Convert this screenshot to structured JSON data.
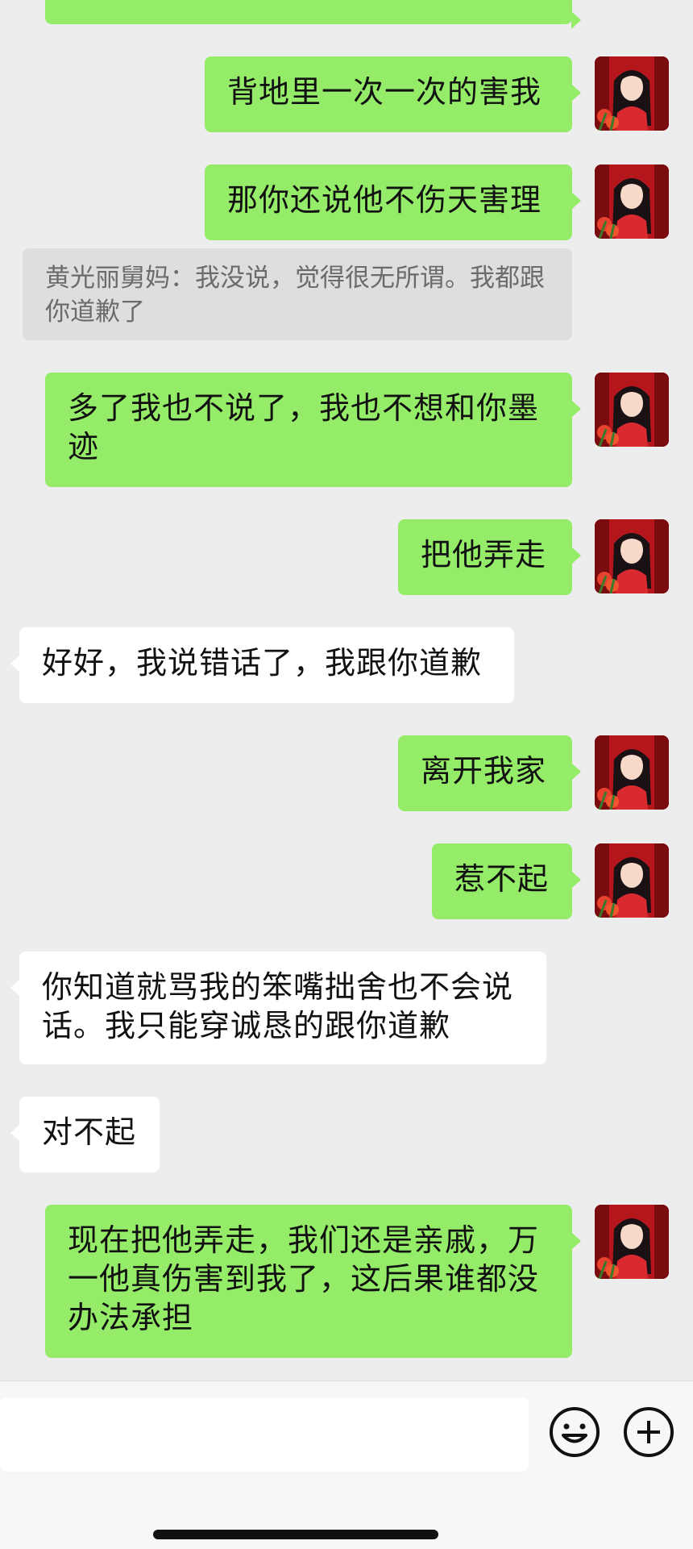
{
  "messages": [
    {
      "side": "me",
      "text": "背地里一次一次的害我"
    },
    {
      "side": "me",
      "text": "那你还说他不伤天害理"
    },
    {
      "side": "quote",
      "text": "黄光丽舅妈：我没说，觉得很无所谓。我都跟你道歉了"
    },
    {
      "side": "me",
      "text": "多了我也不说了，我也不想和你墨迹"
    },
    {
      "side": "me",
      "text": "把他弄走"
    },
    {
      "side": "other",
      "text": "好好，我说错话了，我跟你道歉"
    },
    {
      "side": "me",
      "text": "离开我家"
    },
    {
      "side": "me",
      "text": "惹不起"
    },
    {
      "side": "other",
      "text": "你知道就骂我的笨嘴拙舍也不会说话。我只能穿诚恳的跟你道歉"
    },
    {
      "side": "other",
      "text": "对不起"
    },
    {
      "side": "me",
      "text": "现在把他弄走，我们还是亲戚，万一他真伤害到我了，这后果谁都没办法承担"
    }
  ],
  "input": {
    "value": "",
    "emoji_icon": "smiley-icon",
    "more_icon": "plus-circle-icon"
  },
  "colors": {
    "background": "#ededed",
    "my_bubble": "#95ec69",
    "other_bubble": "#ffffff",
    "quote_bubble": "#dedede"
  }
}
